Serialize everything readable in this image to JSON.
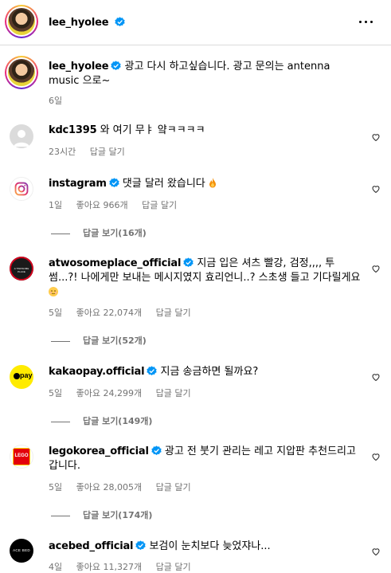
{
  "post_header": {
    "username": "lee_hyolee",
    "more_icon": "more-horizontal-icon"
  },
  "caption": {
    "username": "lee_hyolee",
    "text": "광고 다시 하고싶습니다. 광고 문의는 antenna music 으로~",
    "time": "6일"
  },
  "comments": [
    {
      "username": "kdc1395",
      "verified": false,
      "text": "와 여기 무ㅑ 얔ㅋㅋㅋㅋ",
      "time": "23시간",
      "likes": "",
      "reply": "답글 달기",
      "view_replies": ""
    },
    {
      "username": "instagram",
      "verified": true,
      "text": "댓글 달러 왔습니다",
      "time": "1일",
      "likes": "좋아요 966개",
      "reply": "답글 달기",
      "view_replies": "답글 보기(16개)"
    },
    {
      "username": "atwosomeplace_official",
      "verified": true,
      "text": "지금 입은 셔츠 빨강, 검정,,,, 투썸...?! 나에게만 보내는 메시지였지 효리언니..? 스초생 들고 기다릴게요",
      "time": "5일",
      "likes": "좋아요 22,074개",
      "reply": "답글 달기",
      "view_replies": "답글 보기(52개)"
    },
    {
      "username": "kakaopay.official",
      "verified": true,
      "text": "지금 송금하면 될까요?",
      "time": "5일",
      "likes": "좋아요 24,299개",
      "reply": "답글 달기",
      "view_replies": "답글 보기(149개)"
    },
    {
      "username": "legokorea_official",
      "verified": true,
      "text": "광고 전 붓기 관리는 레고 지압판 추천드리고 갑니다.",
      "time": "5일",
      "likes": "좋아요 28,005개",
      "reply": "답글 달기",
      "view_replies": "답글 보기(174개)"
    },
    {
      "username": "acebed_official",
      "verified": true,
      "text": "보검이 눈치보다 늦었쟈나...",
      "time": "4일",
      "likes": "좋아요 11,327개",
      "reply": "답글 달기",
      "view_replies": ""
    }
  ],
  "avatar_labels": {
    "atwosome": "A TWOSOME PLACE",
    "kakaopay": "pay",
    "lego": "LEGO",
    "acebed": "ACE BED"
  },
  "colors": {
    "verified": "#0095f6",
    "secondary_text": "#737373",
    "divider": "#dbdbdb"
  }
}
